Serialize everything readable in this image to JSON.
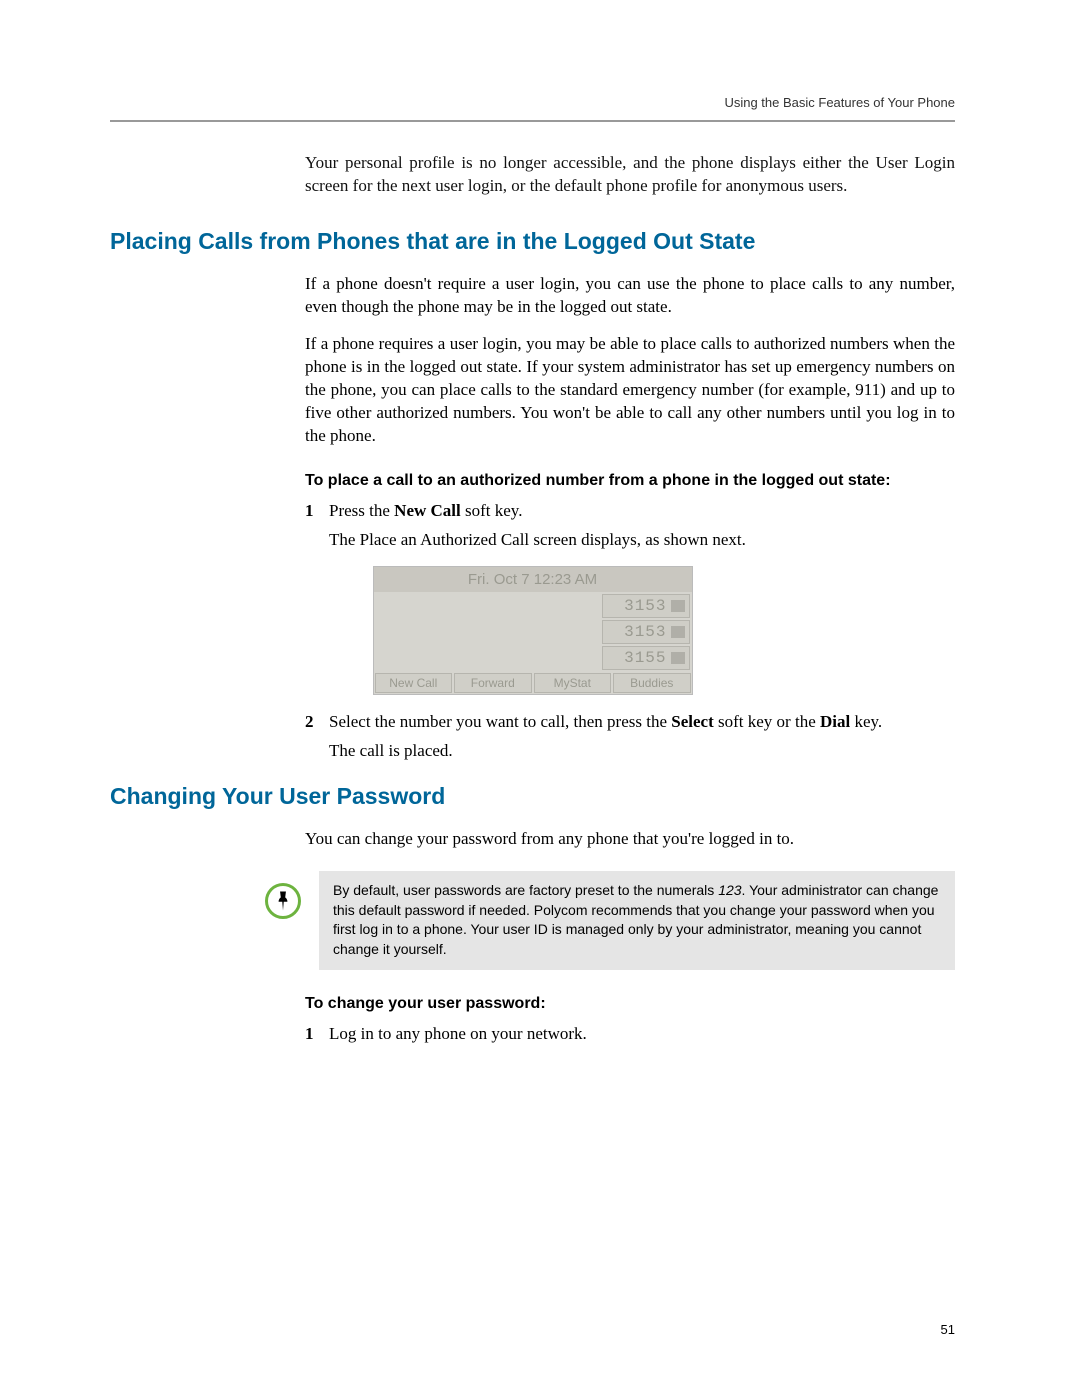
{
  "header": {
    "running_title": "Using the Basic Features of Your Phone"
  },
  "intro_paragraph": "Your personal profile is no longer accessible, and the phone displays either the User Login screen for the next user login, or the default phone profile for anonymous users.",
  "section1": {
    "heading": "Placing Calls from Phones that are in the Logged Out State",
    "para1": "If a phone doesn't require a user login, you can use the phone to place calls to any number, even though the phone may be in the logged out state.",
    "para2": "If a phone requires a user login, you may be able to place calls to authorized numbers when the phone is in the logged out state. If your system administrator has set up emergency numbers on the phone, you can place calls to the standard emergency number (for example, 911) and up to five other authorized numbers. You won't be able to call any other numbers until you log in to the phone.",
    "procedure_heading": "To place a call to an authorized number from a phone in the logged out state:",
    "step1_num": "1",
    "step1_pre": "Press the ",
    "step1_bold": "New Call",
    "step1_post": " soft key.",
    "step1_follow": "The Place an Authorized Call screen displays, as shown next.",
    "phone": {
      "topbar": "Fri. Oct 7 12:23 AM",
      "lines": [
        "3153",
        "3153",
        "3155"
      ],
      "softkeys": [
        "New Call",
        "Forward",
        "MyStat",
        "Buddies"
      ]
    },
    "step2_num": "2",
    "step2_pre": "Select the number you want to call, then press the ",
    "step2_bold1": "Select",
    "step2_mid": " soft key or the ",
    "step2_bold2": "Dial",
    "step2_post": " key.",
    "step2_follow": "The call is placed."
  },
  "section2": {
    "heading": "Changing Your User Password",
    "para1": "You can change your password from any phone that you're logged in to.",
    "note_pre": "By default, user passwords are factory preset to the numerals ",
    "note_italic": "123",
    "note_post": ". Your administrator can change this default password if needed. Polycom recommends that you change your password when you first log in to a phone. Your user ID is managed only by your administrator, meaning you cannot change it yourself.",
    "procedure_heading": "To change your user password:",
    "step1_num": "1",
    "step1_text": "Log in to any phone on your network."
  },
  "page_number": "51"
}
